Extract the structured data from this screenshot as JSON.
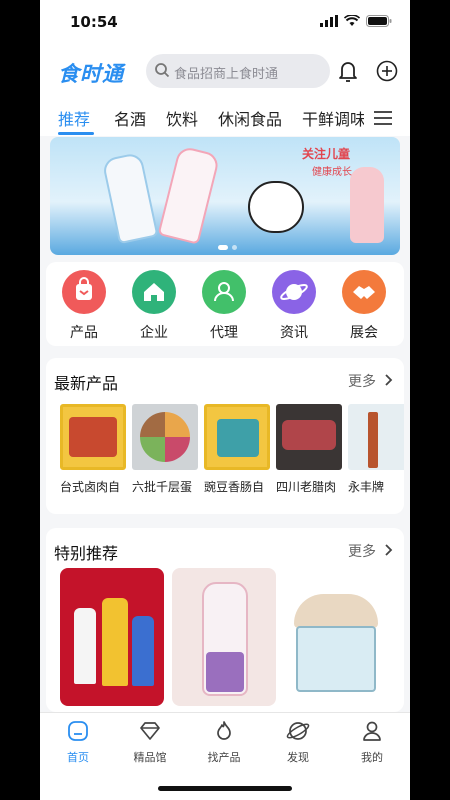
{
  "status": {
    "time": "10:54"
  },
  "header": {
    "logo": "食时通",
    "search_placeholder": "食品招商上食时通"
  },
  "tabs": [
    "推荐",
    "名酒",
    "饮料",
    "休闲食品",
    "干鲜调味"
  ],
  "banner": {
    "headline": "关注儿童",
    "sub": "健康成长"
  },
  "categories": [
    {
      "label": "产品",
      "icon": "bag-icon",
      "color": "#f05a5a"
    },
    {
      "label": "企业",
      "icon": "house-icon",
      "color": "#2fb37a"
    },
    {
      "label": "代理",
      "icon": "person-icon",
      "color": "#42c06a"
    },
    {
      "label": "资讯",
      "icon": "planet-icon",
      "color": "#8a63e6"
    },
    {
      "label": "展会",
      "icon": "handshake-icon",
      "color": "#f37a3c"
    }
  ],
  "latest": {
    "title": "最新产品",
    "more": "更多",
    "items": [
      "台式卤肉自",
      "六批千层蛋",
      "豌豆香肠自",
      "四川老腊肉",
      "永丰牌"
    ]
  },
  "featured": {
    "title": "特别推荐",
    "more": "更多"
  },
  "nav": [
    {
      "label": "首页",
      "icon": "home-icon"
    },
    {
      "label": "精品馆",
      "icon": "diamond-icon"
    },
    {
      "label": "找产品",
      "icon": "flame-icon"
    },
    {
      "label": "发现",
      "icon": "compass-planet-icon"
    },
    {
      "label": "我的",
      "icon": "user-icon"
    }
  ],
  "colors": {
    "accent": "#2a8ef0"
  }
}
